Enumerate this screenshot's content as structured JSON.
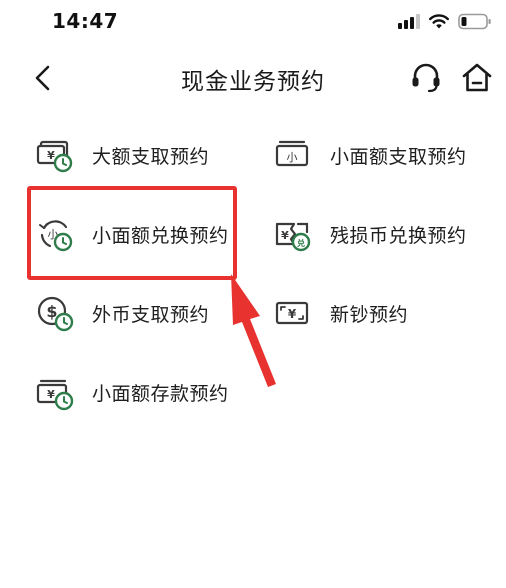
{
  "status_bar": {
    "time": "14:47"
  },
  "nav": {
    "title": "现金业务预约",
    "back_icon": "chevron-left-icon",
    "service_icon": "headset-icon",
    "home_icon": "home-icon"
  },
  "menu": {
    "items": [
      {
        "label": "大额支取预约",
        "icon": "large-withdrawal-icon"
      },
      {
        "label": "小面额支取预约",
        "icon": "small-withdrawal-icon"
      },
      {
        "label": "小面额兑换预约",
        "icon": "small-exchange-icon"
      },
      {
        "label": "残损币兑换预约",
        "icon": "damaged-currency-icon"
      },
      {
        "label": "外币支取预约",
        "icon": "foreign-currency-icon"
      },
      {
        "label": "新钞预约",
        "icon": "new-banknote-icon"
      },
      {
        "label": "小面额存款预约",
        "icon": "small-deposit-icon"
      }
    ]
  },
  "annotation": {
    "highlighted_item": "小面额兑换预约",
    "color": "#e8322f"
  },
  "colors": {
    "icon_dark": "#3a3a3a",
    "icon_green": "#2e7d4a",
    "text": "#1e1e1e",
    "background": "#ffffff"
  }
}
